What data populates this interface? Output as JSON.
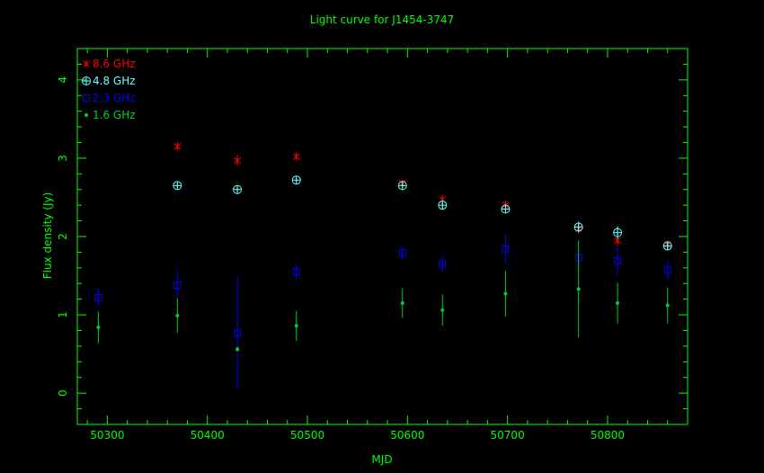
{
  "chart_data": {
    "type": "scatter",
    "title": "Light curve for J1454-3747",
    "xlabel": "MJD",
    "ylabel": "Flux density (Jy)",
    "xlim": [
      50270,
      50880
    ],
    "ylim": [
      -0.4,
      4.4
    ],
    "xticks": [
      50300,
      50400,
      50500,
      50600,
      50700,
      50800
    ],
    "yticks": [
      0,
      1,
      2,
      3,
      4
    ],
    "grid": false,
    "legend_position": "top-left",
    "colors": {
      "background": "#000000",
      "axes": "#00ff00",
      "text": "#00ff00",
      "title": "#00ff00"
    },
    "series": [
      {
        "name": "8.6 GHz",
        "marker": "asterisk",
        "color": "#ff0000",
        "points": [
          {
            "x": 50370,
            "y": 3.15,
            "err": 0.05
          },
          {
            "x": 50430,
            "y": 2.97,
            "err": 0.07
          },
          {
            "x": 50489,
            "y": 3.02,
            "err": 0.04
          },
          {
            "x": 50595,
            "y": 2.68,
            "err": 0.05
          },
          {
            "x": 50635,
            "y": 2.47,
            "err": 0.06
          },
          {
            "x": 50698,
            "y": 2.4,
            "err": 0.06
          },
          {
            "x": 50771,
            "y": 2.1,
            "err": 0.06
          },
          {
            "x": 50810,
            "y": 1.95,
            "err": 0.07
          },
          {
            "x": 50860,
            "y": 1.9,
            "err": 0.05
          }
        ]
      },
      {
        "name": "4.8 GHz",
        "marker": "circle-plus",
        "color": "#66ffff",
        "points": [
          {
            "x": 50370,
            "y": 2.65,
            "err": 0.03
          },
          {
            "x": 50430,
            "y": 2.6,
            "err": 0.03
          },
          {
            "x": 50489,
            "y": 2.72,
            "err": 0.03
          },
          {
            "x": 50595,
            "y": 2.65,
            "err": 0.03
          },
          {
            "x": 50635,
            "y": 2.4,
            "err": 0.04
          },
          {
            "x": 50698,
            "y": 2.35,
            "err": 0.05
          },
          {
            "x": 50771,
            "y": 2.12,
            "err": 0.07
          },
          {
            "x": 50810,
            "y": 2.05,
            "err": 0.08
          },
          {
            "x": 50860,
            "y": 1.88,
            "err": 0.05
          }
        ]
      },
      {
        "name": "2.3 GHz",
        "marker": "square",
        "color": "#0000ff",
        "points": [
          {
            "x": 50291,
            "y": 1.22,
            "err": 0.12
          },
          {
            "x": 50370,
            "y": 1.38,
            "err": 0.22
          },
          {
            "x": 50430,
            "y": 0.77,
            "err": 0.72
          },
          {
            "x": 50489,
            "y": 1.55,
            "err": 0.1
          },
          {
            "x": 50595,
            "y": 1.79,
            "err": 0.08
          },
          {
            "x": 50635,
            "y": 1.65,
            "err": 0.1
          },
          {
            "x": 50698,
            "y": 1.84,
            "err": 0.18
          },
          {
            "x": 50771,
            "y": 1.73,
            "err": 0.15
          },
          {
            "x": 50810,
            "y": 1.69,
            "err": 0.18
          },
          {
            "x": 50860,
            "y": 1.57,
            "err": 0.12
          }
        ]
      },
      {
        "name": "1.6 GHz",
        "marker": "dot",
        "color": "#00cc33",
        "points": [
          {
            "x": 50291,
            "y": 0.84,
            "err": 0.2
          },
          {
            "x": 50370,
            "y": 0.99,
            "err": 0.22
          },
          {
            "x": 50430,
            "y": 0.56,
            "err": 0.03
          },
          {
            "x": 50489,
            "y": 0.86,
            "err": 0.19
          },
          {
            "x": 50595,
            "y": 1.15,
            "err": 0.19
          },
          {
            "x": 50635,
            "y": 1.06,
            "err": 0.2
          },
          {
            "x": 50698,
            "y": 1.27,
            "err": 0.29
          },
          {
            "x": 50771,
            "y": 1.33,
            "err": 0.62
          },
          {
            "x": 50810,
            "y": 1.15,
            "err": 0.26
          },
          {
            "x": 50860,
            "y": 1.12,
            "err": 0.23
          }
        ]
      }
    ]
  }
}
